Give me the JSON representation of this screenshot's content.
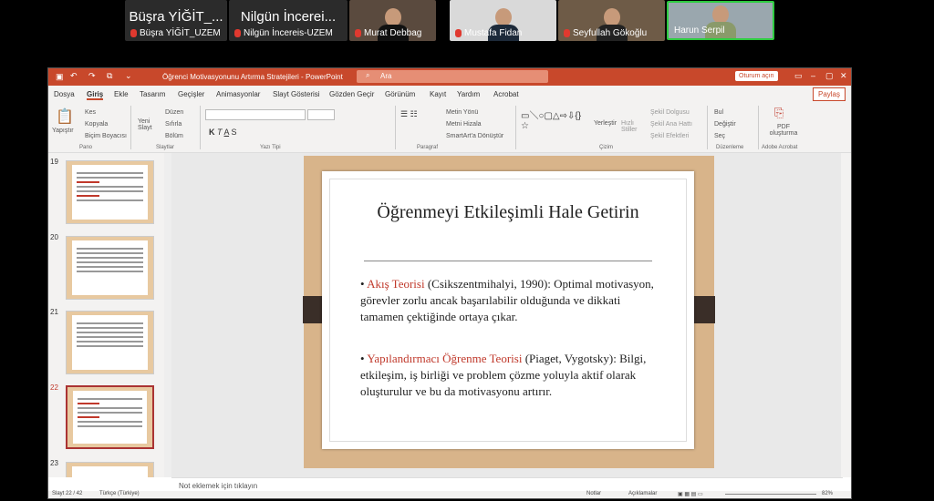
{
  "meeting": {
    "tile1": {
      "big": "Büşra YİĞİT_...",
      "label": "Büşra YİĞİT_UZEM"
    },
    "tile2": {
      "big": "Nilgün İncerei...",
      "label": "Nilgün İncereis-UZEM"
    },
    "tile3": {
      "label": "Murat Debbag"
    },
    "tile4": {
      "label": "Mustafa Fidan"
    },
    "tile5": {
      "label": "Seyfullah Gökoğlu"
    },
    "tile6": {
      "label": "Harun Serpil"
    }
  },
  "ppt": {
    "title": "Öğrenci Motivasyonunu Artırma Stratejileri - PowerPoint",
    "search": "Ara",
    "signin": "Oturum açın",
    "share": "Paylaş",
    "menu": [
      "Dosya",
      "Giriş",
      "Ekle",
      "Tasarım",
      "Geçişler",
      "Animasyonlar",
      "Slayt Gösterisi",
      "Gözden Geçir",
      "Görünüm",
      "Kayıt",
      "Yardım",
      "Acrobat"
    ],
    "ribbon": {
      "paste": "Yapıştır",
      "cut": "Kes",
      "copy": "Kopyala",
      "format": "Biçim Boyacısı",
      "new_slide": "Yeni Slayt",
      "layout": "Düzen",
      "reset": "Sıfırla",
      "section": "Bölüm",
      "text_dir": "Metin Yönü",
      "align_text": "Metni Hizala",
      "smartart": "SmartArt'a Dönüştür",
      "arrange": "Yerleştir",
      "quick": "Hızlı Stiller",
      "fill": "Şekil Dolgusu",
      "outline": "Şekil Ana Hattı",
      "effects": "Şekil Efektleri",
      "find": "Bul",
      "replace": "Değiştir",
      "select": "Seç",
      "pdf": "PDF oluşturma",
      "groups": [
        "Pano",
        "Slaytlar",
        "Yazı Tipi",
        "Paragraf",
        "Çizim",
        "Düzenleme",
        "Adobe Acrobat"
      ]
    },
    "slide_nums": [
      "19",
      "20",
      "21",
      "22",
      "23"
    ],
    "slide": {
      "title": "Öğrenmeyi Etkileşimli Hale Getirin",
      "b1_red": "Akış Teorisi",
      "b1_rest": " (Csikszentmihalyi, 1990): Optimal motivasyon, görevler zorlu ancak başarılabilir olduğunda ve dikkati tamamen çektiğinde ortaya çıkar.",
      "b2_red": "Yapılandırmacı Öğrenme Teorisi",
      "b2_rest": " (Piaget, Vygotsky): Bilgi, etkileşim, iş birliği ve problem çözme yoluyla aktif olarak oluşturulur ve bu da motivasyonu artırır."
    },
    "notes": "Not eklemek için tıklayın",
    "status": {
      "slide": "Slayt 22 / 42",
      "lang": "Türkçe (Türkiye)",
      "notes": "Notlar",
      "comments": "Açıklamalar",
      "zoom": "82%"
    }
  }
}
